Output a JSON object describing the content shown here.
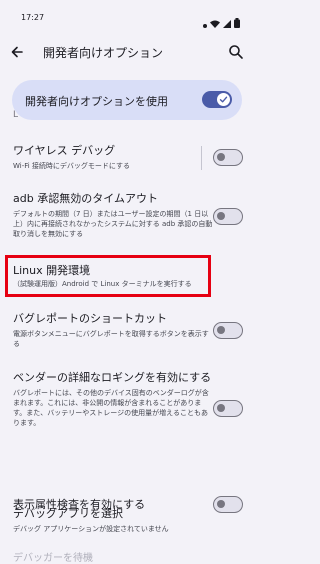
{
  "status": {
    "time": "17:27"
  },
  "appbar": {
    "title": "開発者向けオプション"
  },
  "master": {
    "label": "開発者向けオプションを使用",
    "enabled": true
  },
  "edge_text": "L",
  "items": [
    {
      "title": "ワイヤレス デバッグ",
      "sub": "Wi-Fi 接続時にデバッグモードにする"
    },
    {
      "title": "adb 承認無効のタイムアウト",
      "sub": "デフォルトの期間（7 日）またはユーザー設定の期間（1 日以上）内に再接続されなかったシステムに対する adb 承認の自動取り消しを無効にする"
    },
    {
      "title": "Linux 開発環境",
      "sub": "（試験運用版）Android で Linux ターミナルを実行する"
    },
    {
      "title": "バグレポートのショートカット",
      "sub": "電源ボタンメニューにバグレポートを取得するボタンを表示する"
    },
    {
      "title": "ベンダーの詳細なロギングを有効にする",
      "sub": "バグレポートには、その他のデバイス固有のベンダーログが含まれます。これには、非公開の情報が含まれることがあります。また、バッテリーやストレージの使用量が増えることもあります。"
    },
    {
      "title": "表示属性検査を有効にする",
      "sub": ""
    },
    {
      "title": "デバッグアプリを選択",
      "sub": "デバッグ アプリケーションが設定されていません"
    }
  ],
  "bottom_fade_text": "デバッガーを待機"
}
